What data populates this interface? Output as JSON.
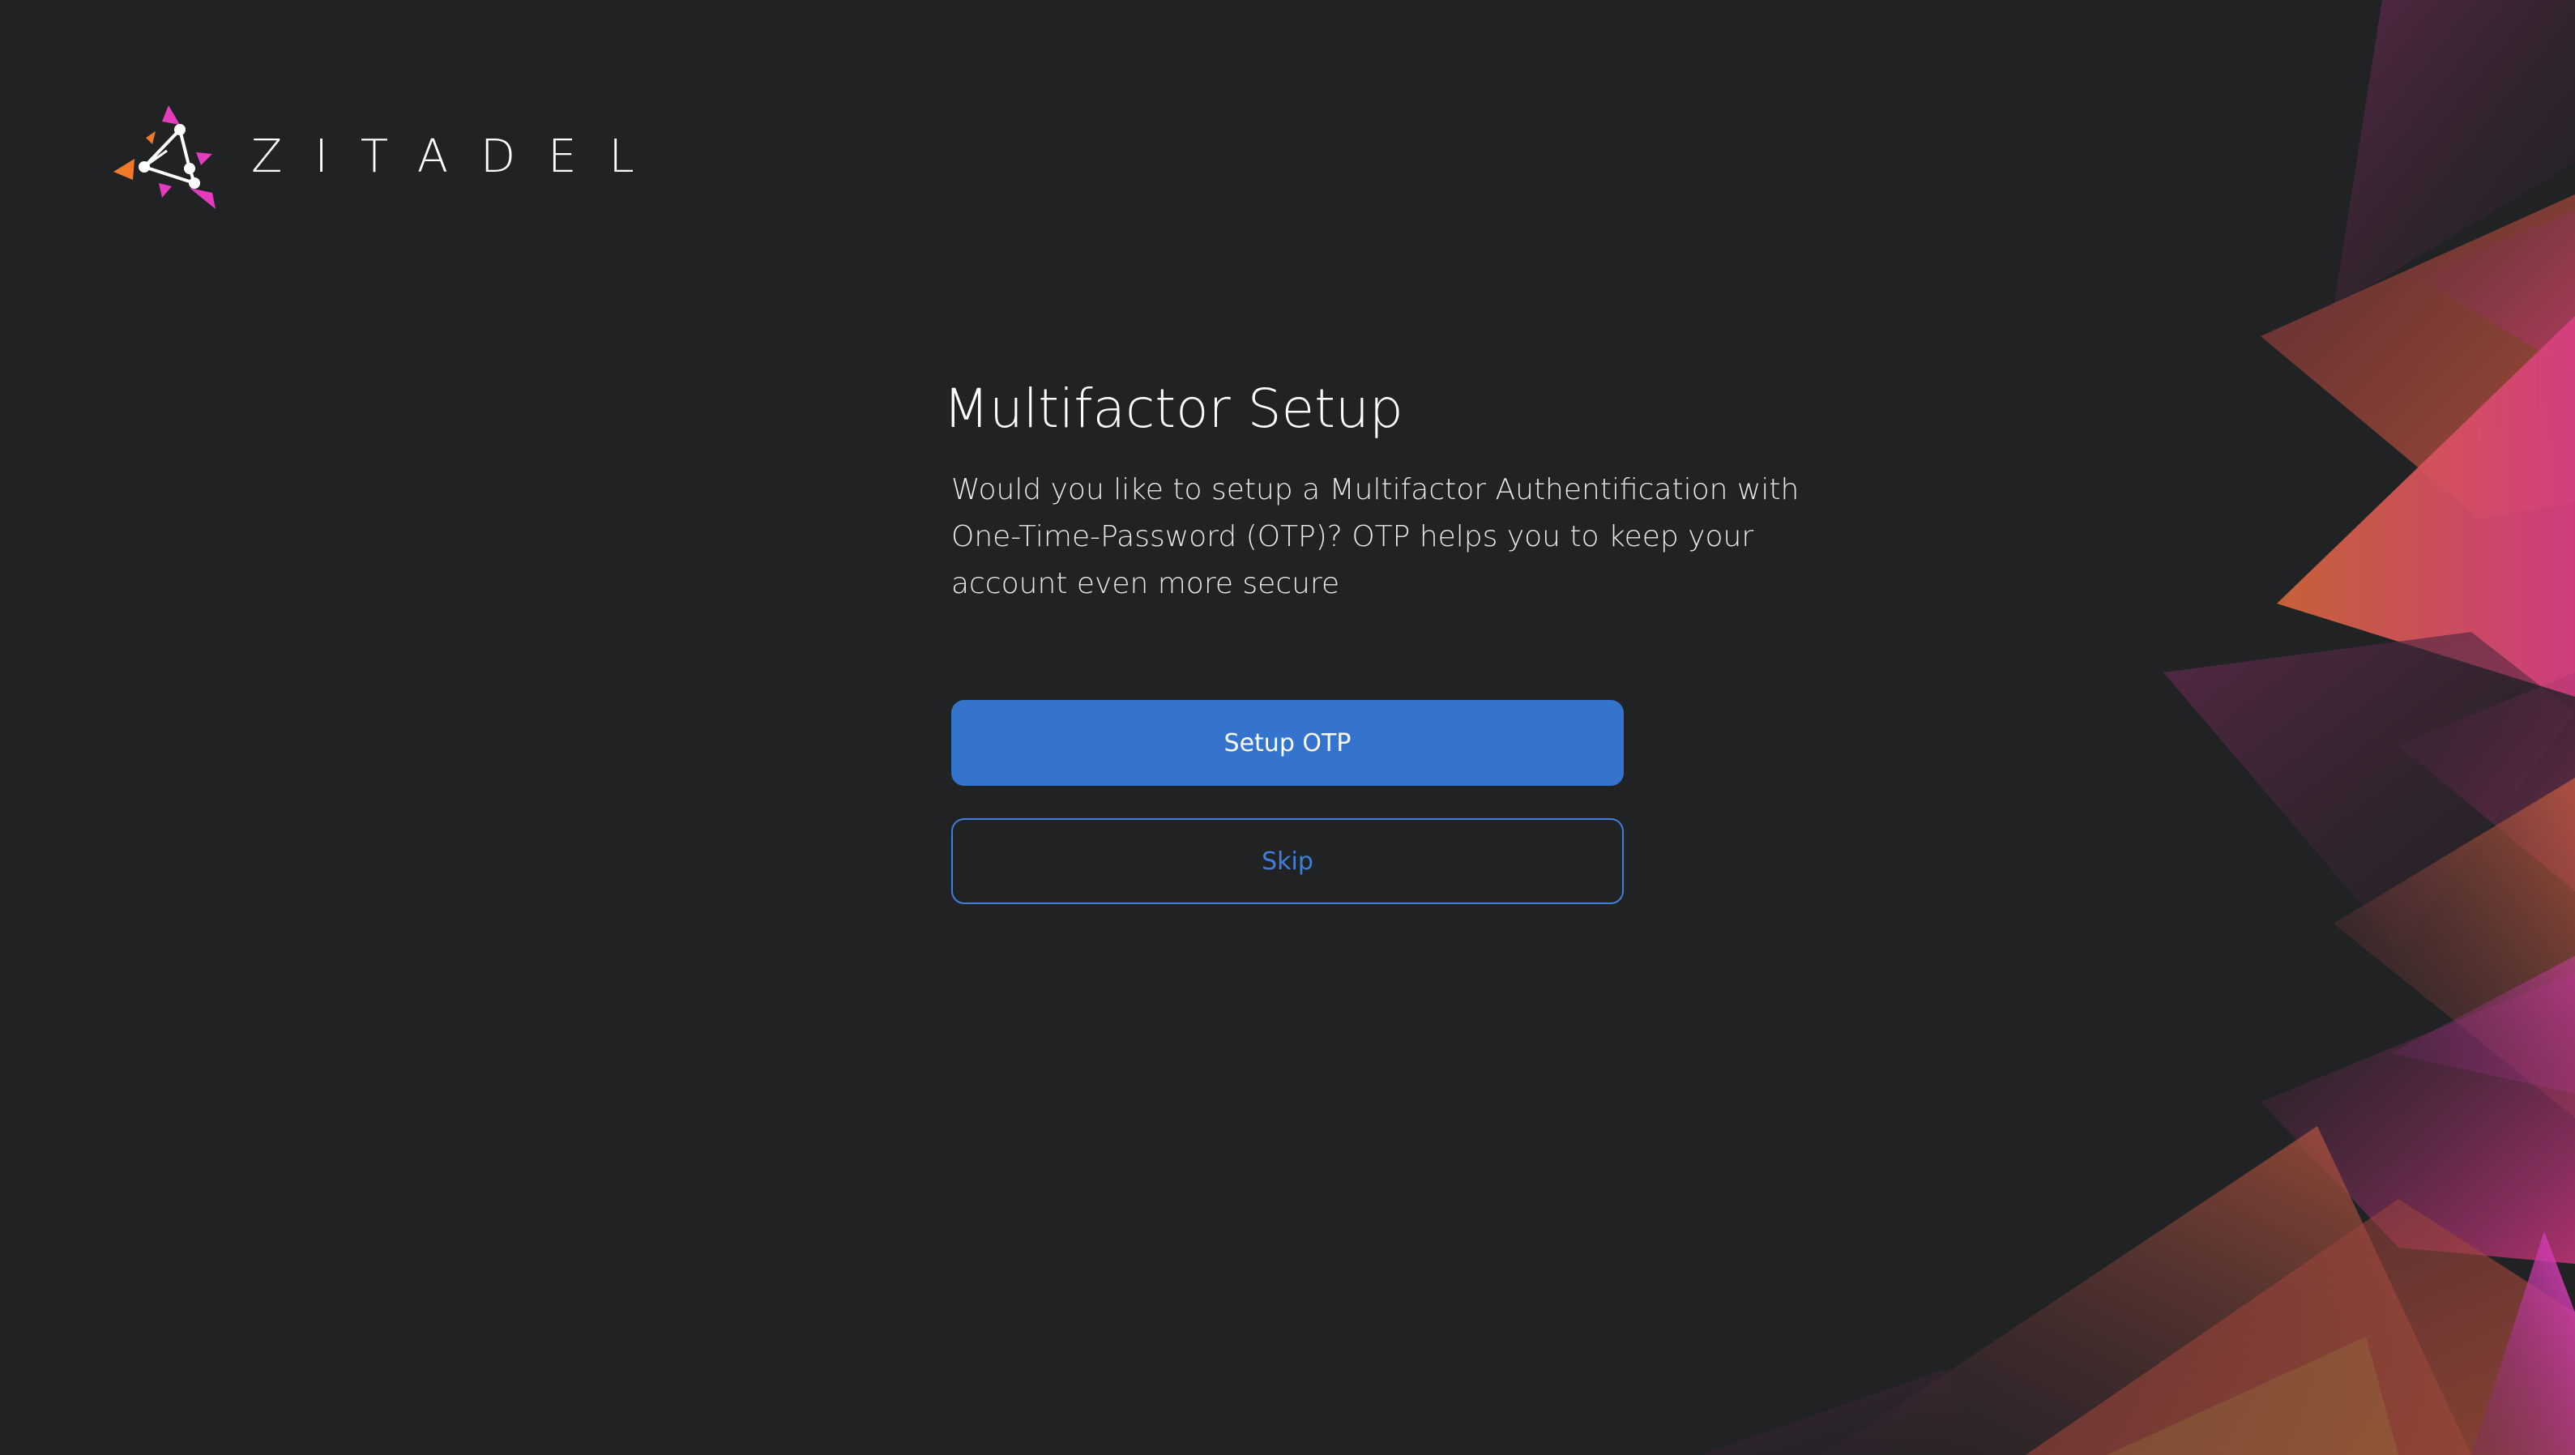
{
  "brand": {
    "name": "ZITADEL",
    "logo_icon": "zitadel-triangle-logo-icon"
  },
  "main": {
    "title": "Multifactor Setup",
    "description": "Would you like to setup a Multifactor Authentification with One-Time-Password (OTP)? OTP helps you to keep your account even more secure",
    "primary_button_label": "Setup OTP",
    "secondary_button_label": "Skip"
  },
  "colors": {
    "background": "#212224",
    "primary": "#3574cc",
    "secondary_outline": "#3f7fdb",
    "accent_pink": "#e33cbf",
    "accent_orange": "#f07a2a"
  }
}
